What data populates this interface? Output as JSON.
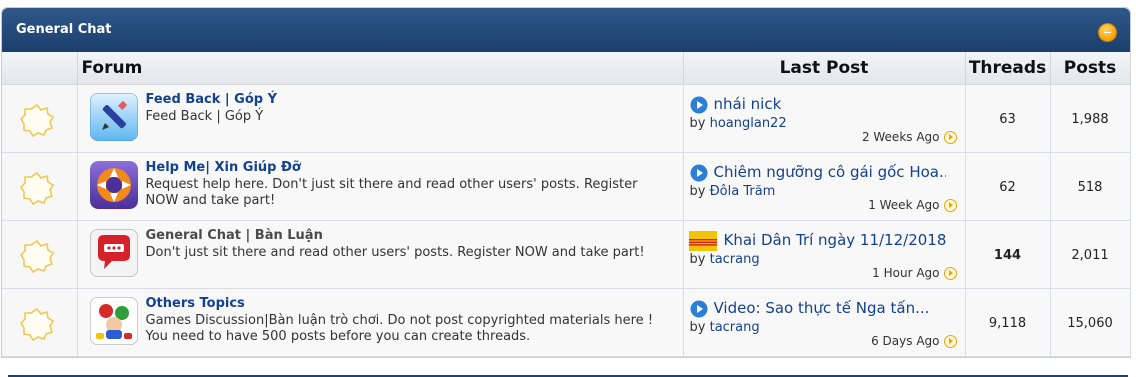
{
  "header": {
    "title": "General Chat"
  },
  "columns": {
    "forum": "Forum",
    "last_post": "Last Post",
    "threads": "Threads",
    "posts": "Posts"
  },
  "by_label": "by",
  "colors": {
    "header_bg": "#1b3e6c",
    "link": "#14418f",
    "collapse": "#f5a100"
  },
  "forums": [
    {
      "icon": "pencil-icon",
      "title": "Feed Back | Góp Ý",
      "description": "Feed Back | Góp Ý",
      "last_post": {
        "icon": "play-arrow-icon",
        "title": "nhái nick",
        "by": "hoanglan22",
        "time": "2 Weeks Ago"
      },
      "threads": "63",
      "posts": "1,988"
    },
    {
      "icon": "lifebuoy-icon",
      "title": "Help Me| Xin Giúp Đỡ",
      "description": "Request help here. Don't just sit there and read other users' posts. Register NOW and take part!",
      "last_post": {
        "icon": "play-arrow-icon",
        "title": "Chiêm ngưỡng cô gái gốc Hoa...",
        "by": "Đôla Trăm",
        "time": "1 Week Ago"
      },
      "threads": "62",
      "posts": "518"
    },
    {
      "icon": "chat-bubble-icon",
      "title": "General Chat | Bàn Luận",
      "description": "Don't just sit there and read other users' posts. Register NOW and take part!",
      "last_post": {
        "icon": "flag-icon",
        "title": "Khai Dân Trí ngày 11/12/2018",
        "by": "tacrang",
        "time": "1 Hour Ago"
      },
      "threads": "144",
      "posts": "2,011"
    },
    {
      "icon": "mario-game-icon",
      "title": "Others Topics",
      "description": "Games Discussion|Bàn luận trò chơi. Do not post copyrighted materials here ! You need to have 500 posts before you can create threads.",
      "last_post": {
        "icon": "play-arrow-icon",
        "title": "Video: Sao thực tế Nga tấn...",
        "by": "tacrang",
        "time": "6 Days Ago"
      },
      "threads": "9,118",
      "posts": "15,060"
    }
  ]
}
